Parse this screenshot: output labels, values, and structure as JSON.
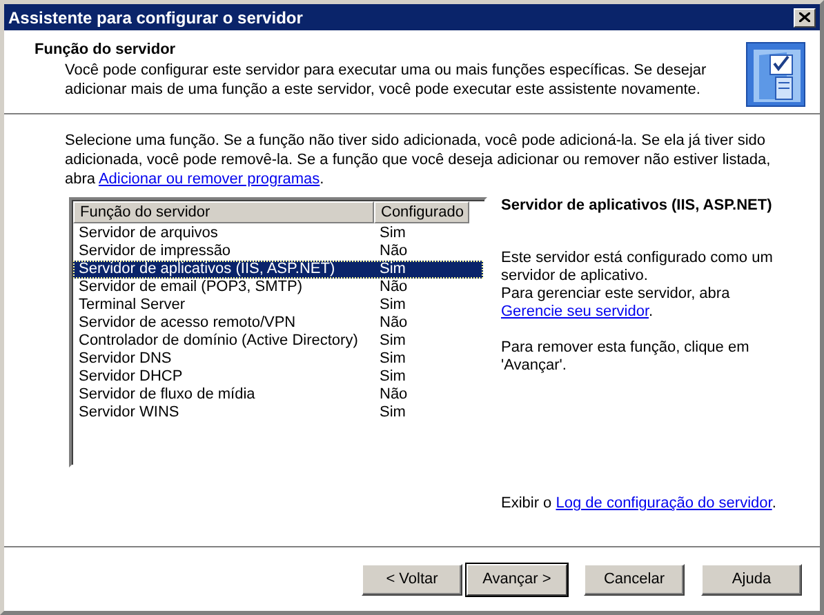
{
  "window": {
    "title": "Assistente para configurar o servidor"
  },
  "header": {
    "title": "Função do servidor",
    "description": "Você pode configurar este servidor para executar uma ou mais funções específicas. Se desejar adicionar mais de uma função a este servidor, você pode executar este assistente novamente."
  },
  "intro": [
    {
      "kind": "text",
      "text": "Selecione uma função. Se a função não tiver sido adicionada, você pode adicioná-la. Se ela já tiver sido adicionada, você pode removê-la. Se a função que você deseja adicionar ou remover não estiver listada, abra "
    },
    {
      "kind": "link",
      "text": "Adicionar ou remover programas"
    },
    {
      "kind": "text",
      "text": "."
    }
  ],
  "table": {
    "columns": [
      "Função do servidor",
      "Configurado"
    ],
    "rows": [
      {
        "role": "Servidor de arquivos",
        "configured": "Sim",
        "selected": false
      },
      {
        "role": "Servidor de impressão",
        "configured": "Não",
        "selected": false
      },
      {
        "role": "Servidor de aplicativos (IIS, ASP.NET)",
        "configured": "Sim",
        "selected": true
      },
      {
        "role": "Servidor de email (POP3, SMTP)",
        "configured": "Não",
        "selected": false
      },
      {
        "role": "Terminal Server",
        "configured": "Sim",
        "selected": false
      },
      {
        "role": "Servidor de acesso remoto/VPN",
        "configured": "Não",
        "selected": false
      },
      {
        "role": "Controlador de domínio (Active Directory)",
        "configured": "Sim",
        "selected": false
      },
      {
        "role": "Servidor DNS",
        "configured": "Sim",
        "selected": false
      },
      {
        "role": "Servidor DHCP",
        "configured": "Sim",
        "selected": false
      },
      {
        "role": "Servidor de fluxo de mídia",
        "configured": "Não",
        "selected": false
      },
      {
        "role": "Servidor WINS",
        "configured": "Sim",
        "selected": false
      }
    ]
  },
  "details": {
    "title": "Servidor de aplicativos (IIS, ASP.NET)",
    "paragraphs": [
      [
        {
          "kind": "text",
          "text": "Este servidor está configurado como um servidor de aplicativo."
        },
        {
          "kind": "break"
        },
        {
          "kind": "text",
          "text": "Para gerenciar este servidor, abra "
        },
        {
          "kind": "link",
          "text": "Gerencie seu servidor"
        },
        {
          "kind": "text",
          "text": "."
        }
      ],
      [
        {
          "kind": "text",
          "text": "Para remover esta função, clique em 'Avançar'."
        }
      ]
    ],
    "footer": [
      {
        "kind": "text",
        "text": "Exibir o "
      },
      {
        "kind": "link",
        "text": "Log de configuração do servidor"
      },
      {
        "kind": "text",
        "text": "."
      }
    ]
  },
  "buttons": [
    {
      "label": "< Voltar",
      "default": false
    },
    {
      "label": "Avançar >",
      "default": true
    },
    {
      "label": "Cancelar",
      "default": false
    },
    {
      "label": "Ajuda",
      "default": false
    }
  ]
}
